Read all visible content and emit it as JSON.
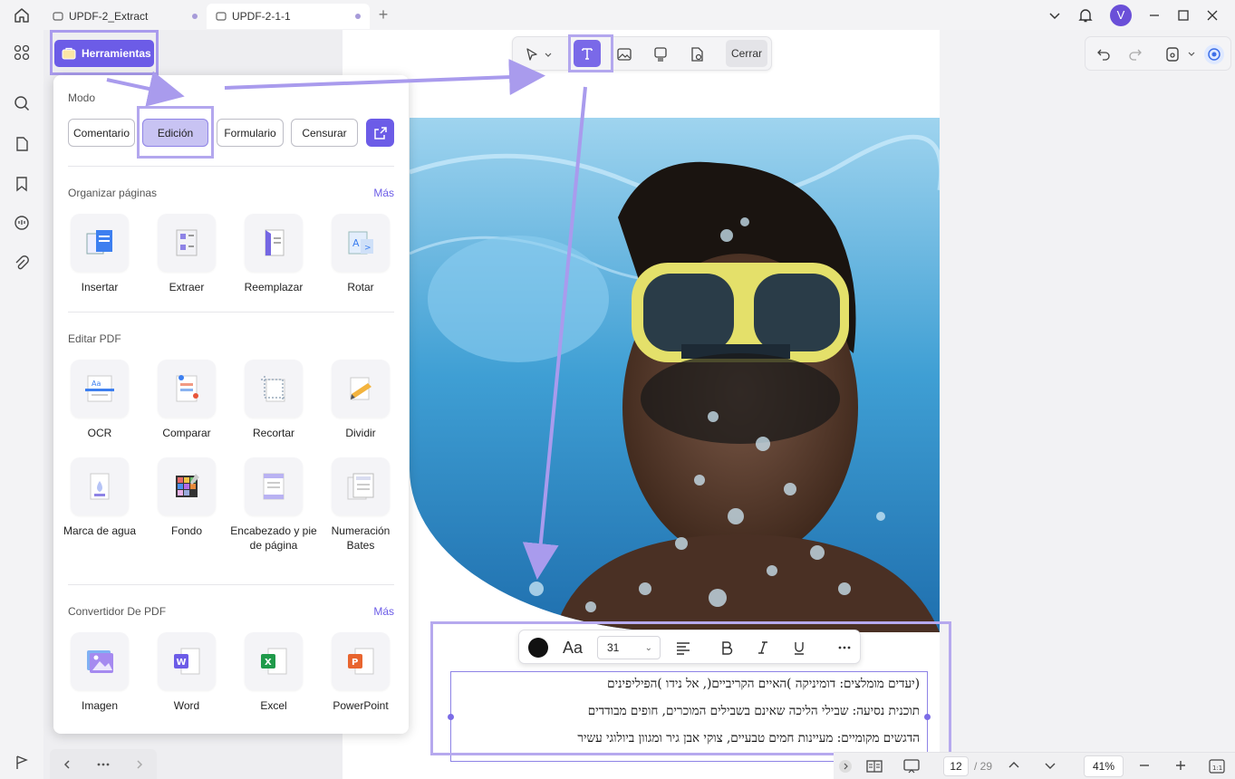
{
  "titlebar": {
    "tabs": [
      {
        "label": "UPDF-2_Extract",
        "active": false
      },
      {
        "label": "UPDF-2-1-1",
        "active": true
      }
    ],
    "avatar_letter": "V"
  },
  "tools_button": {
    "label": "Herramientas"
  },
  "tools_panel": {
    "mode_title": "Modo",
    "modes": [
      "Comentario",
      "Edición",
      "Formulario",
      "Censurar"
    ],
    "active_mode": "Edición",
    "sections": [
      {
        "title": "Organizar páginas",
        "more": "Más",
        "tools": [
          "Insertar",
          "Extraer",
          "Reemplazar",
          "Rotar"
        ]
      },
      {
        "title": "Editar PDF",
        "more": "",
        "tools": [
          "OCR",
          "Comparar",
          "Recortar",
          "Dividir",
          "Marca de agua",
          "Fondo",
          "Encabezado y pie de página",
          "Numeración Bates"
        ]
      },
      {
        "title": "Convertidor De PDF",
        "more": "Más",
        "tools": [
          "Imagen",
          "Word",
          "Excel",
          "PowerPoint"
        ]
      }
    ]
  },
  "edit_toolbar": {
    "close_label": "Cerrar"
  },
  "format_bar": {
    "font_size": "31",
    "font_glyph": "Aa"
  },
  "text_block": {
    "lines": [
      "(יעדים מומלצים: דומיניקה )האיים הקריביים(, אל נידו )הפיליפינים",
      "תוכנית נסיעה: שבילי הליכה שאינם בשבילים המוכרים, חופים מבודדים",
      "הדגשים מקומיים: מעיינות חמים טבעיים, צוקי אבן גיר ומגוון ביולוגי עשיר"
    ]
  },
  "statusbar": {
    "current_page": "12",
    "total_pages": "/ 29",
    "zoom": "41%"
  },
  "colors": {
    "accent": "#6c5ce7",
    "highlight": "#b3a7ee"
  }
}
